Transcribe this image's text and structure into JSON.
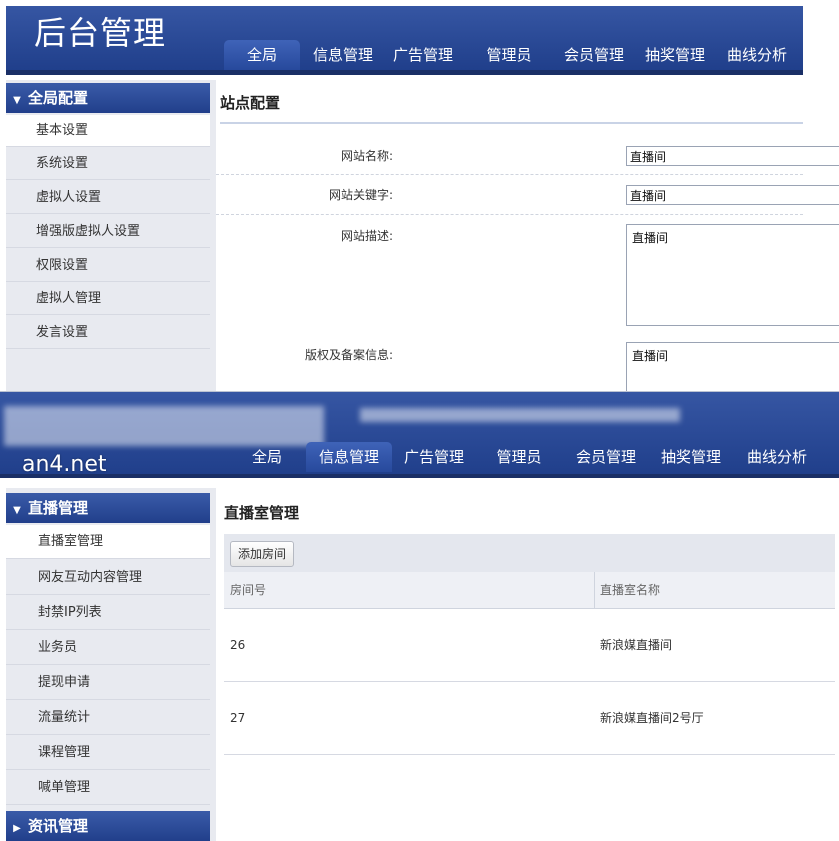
{
  "top": {
    "logo": "后台管理",
    "nav": [
      "全局",
      "信息管理",
      "广告管理",
      "管理员",
      "会员管理",
      "抽奖管理",
      "曲线分析"
    ],
    "active_nav": "全局",
    "sidebar": {
      "header": "全局配置",
      "items": [
        "基本设置",
        "系统设置",
        "虚拟人设置",
        "增强版虚拟人设置",
        "权限设置",
        "虚拟人管理",
        "发言设置"
      ],
      "active_item": "基本设置"
    },
    "content_title": "站点配置",
    "form": {
      "site_name_label": "网站名称:",
      "site_name_value": "直播间",
      "keywords_label": "网站关键字:",
      "keywords_value": "直播间",
      "description_label": "网站描述:",
      "description_value": "直播间",
      "copyright_label": "版权及备案信息:",
      "copyright_value": "直播间"
    }
  },
  "bottom": {
    "watermark": "an4.net",
    "nav": [
      "全局",
      "信息管理",
      "广告管理",
      "管理员",
      "会员管理",
      "抽奖管理",
      "曲线分析"
    ],
    "active_nav": "信息管理",
    "sidebar": {
      "header": "直播管理",
      "items": [
        "直播室管理",
        "网友互动内容管理",
        "封禁IP列表",
        "业务员",
        "提现申请",
        "流量统计",
        "课程管理",
        "喊单管理"
      ],
      "active_item": "直播室管理",
      "footer_header": "资讯管理"
    },
    "content_title": "直播室管理",
    "add_button": "添加房间",
    "table": {
      "columns": [
        "房间号",
        "直播室名称"
      ],
      "rows": [
        [
          "26",
          "新浪媒直播间"
        ],
        [
          "27",
          "新浪媒直播间2号厅"
        ]
      ]
    }
  },
  "colors": {
    "header_blue": "#213f8b",
    "sidebar_bg": "#e8eaf0",
    "border": "#9aa3b4"
  }
}
